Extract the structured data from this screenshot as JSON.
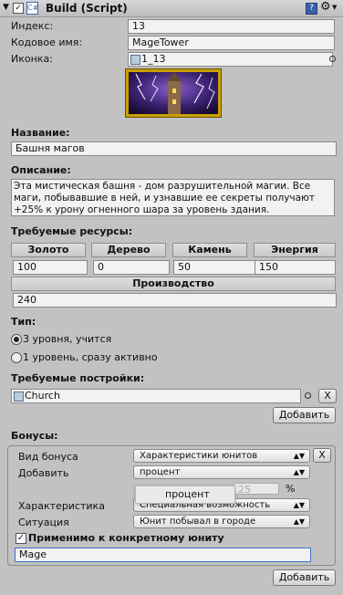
{
  "header": {
    "title": "Build (Script)",
    "enabled": true
  },
  "fields": {
    "index_label": "Индекс:",
    "index_value": "13",
    "code_label": "Кодовое имя:",
    "code_value": "MageTower",
    "icon_label": "Иконка:",
    "icon_value": "1_13"
  },
  "name_section": {
    "label": "Название:",
    "value": "Башня магов"
  },
  "desc_section": {
    "label": "Описание:",
    "line1": "Эта мистическая башня - дом разрушительной магии. Все",
    "line2": "маги, побывавшие в ней, и узнавшие ее секреты получают",
    "line3": "+25% к урону огненного шара за уровень здания."
  },
  "resources": {
    "label": "Требуемые ресурсы:",
    "headers": [
      "Золото",
      "Дерево",
      "Камень",
      "Энергия"
    ],
    "values": [
      "100",
      "0",
      "50",
      "150"
    ]
  },
  "production": {
    "label": "Производство",
    "value": "240"
  },
  "type_section": {
    "label": "Тип:",
    "option1": "3 уровня, учится",
    "option2": "1 уровень, сразу активно",
    "selected": 1
  },
  "required_buildings": {
    "label": "Требуемые постройки:",
    "item": "Church",
    "remove": "X",
    "add_button": "Добавить"
  },
  "bonuses": {
    "label": "Бонусы:",
    "kind_label": "Вид бонуса",
    "kind_value": "Характеристики юнитов",
    "add_label": "Добавить",
    "add_value": "процент",
    "popup_value": "процент",
    "percent_value": "25",
    "percent_sign": "%",
    "stat_label": "Характеристика",
    "stat_value": "Специальная возможность",
    "situation_label": "Ситуация",
    "situation_value": "Юнит побывал в городе",
    "specific_label": "Применимо к конкретному юниту",
    "specific_checked": true,
    "unit_value": "Mage",
    "remove": "X",
    "add_button": "Добавить"
  }
}
